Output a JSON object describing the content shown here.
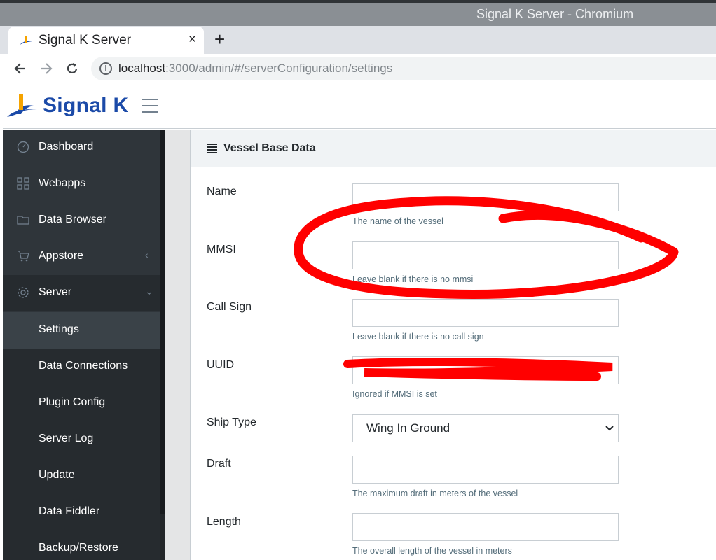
{
  "window": {
    "title": "Signal K Server - Chromium"
  },
  "browser": {
    "tab_title": "Signal K Server",
    "tab_close": "×",
    "new_tab": "+",
    "url_host": "localhost",
    "url_rest": ":3000/admin/#/serverConfiguration/settings"
  },
  "brand": {
    "name": "Signal K"
  },
  "sidebar": {
    "items": [
      {
        "label": "Dashboard",
        "icon": "speedometer-icon"
      },
      {
        "label": "Webapps",
        "icon": "grid-icon"
      },
      {
        "label": "Data Browser",
        "icon": "folder-icon"
      },
      {
        "label": "Appstore",
        "icon": "cart-icon",
        "chevron": "‹"
      },
      {
        "label": "Server",
        "icon": "gear-icon",
        "chevron": "⌄"
      }
    ],
    "sub_items": [
      {
        "label": "Settings",
        "active": true
      },
      {
        "label": "Data Connections"
      },
      {
        "label": "Plugin Config"
      },
      {
        "label": "Server Log"
      },
      {
        "label": "Update"
      },
      {
        "label": "Data Fiddler"
      },
      {
        "label": "Backup/Restore"
      }
    ]
  },
  "card": {
    "title": "Vessel Base Data",
    "fields": {
      "name": {
        "label": "Name",
        "value": "",
        "help": "The name of the vessel"
      },
      "mmsi": {
        "label": "MMSI",
        "value": "",
        "help": "Leave blank if there is no mmsi"
      },
      "callsign": {
        "label": "Call Sign",
        "value": "",
        "help": "Leave blank if there is no call sign"
      },
      "uuid": {
        "label": "UUID",
        "help": "Ignored if MMSI is set"
      },
      "shiptype": {
        "label": "Ship Type",
        "value": "Wing In Ground"
      },
      "draft": {
        "label": "Draft",
        "value": "",
        "help": "The maximum draft in meters of the vessel"
      },
      "length": {
        "label": "Length",
        "value": "",
        "help": "The overall length of the vessel in meters"
      }
    }
  },
  "colors": {
    "brand": "#1b4aa8",
    "sidebar": "#2f353a",
    "annotation": "#ff0000"
  }
}
